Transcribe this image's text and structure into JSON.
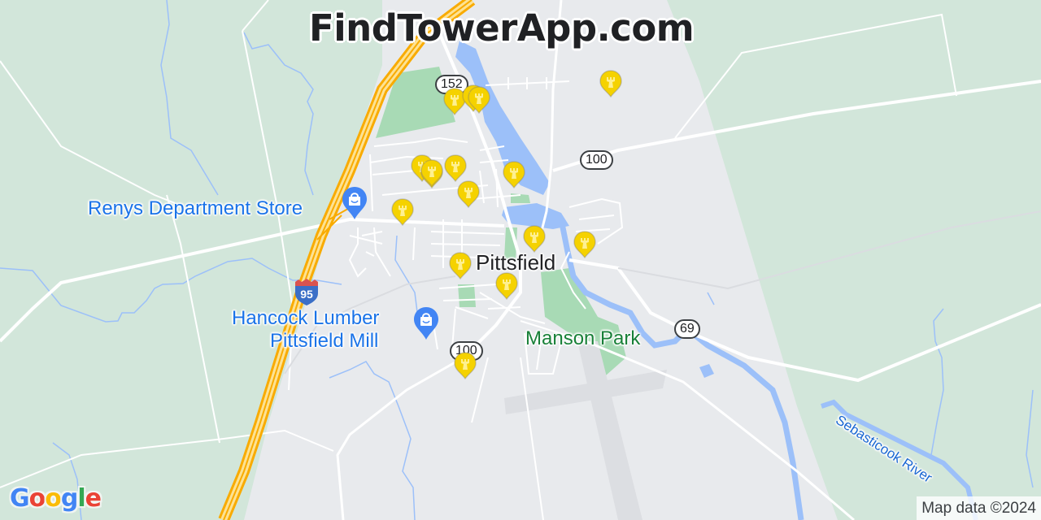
{
  "site_title": "FindTowerApp.com",
  "map": {
    "labels": {
      "town": "Pittsfield",
      "park": "Manson Park",
      "river": "Sebasticook River",
      "poi_renys": "Renys Department Store",
      "poi_hancock_line1": "Hancock Lumber",
      "poi_hancock_line2": "Pittsfield Mill"
    },
    "route_shields": {
      "r152": "152",
      "r100_north": "100",
      "r100_south": "100",
      "r69": "69",
      "i95": "95"
    },
    "colors": {
      "forest": "#d2e6da",
      "land": "#e8eaed",
      "water": "#9cc0f9",
      "park": "#a8dab5",
      "highway": "#f9ab00",
      "highway_fill": "#fde293",
      "road": "#ffffff",
      "tower_marker": "#f5d200",
      "poi_marker": "#4285f4"
    },
    "tower_markers_count": 16,
    "icons": {
      "tower": "cell-tower-marker-icon",
      "shopping": "shopping-bag-icon"
    }
  },
  "branding": {
    "logo_letters": [
      "G",
      "o",
      "o",
      "g",
      "l",
      "e"
    ],
    "logo_colors": [
      "#4285f4",
      "#ea4335",
      "#fbbc05",
      "#4285f4",
      "#34a853",
      "#ea4335"
    ],
    "attribution": "Map data ©2024"
  }
}
